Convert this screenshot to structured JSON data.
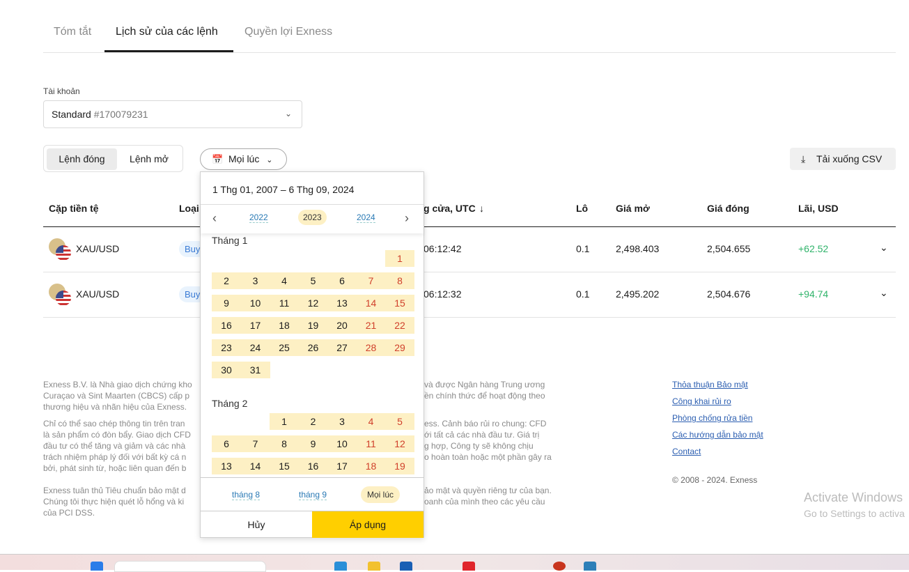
{
  "tabs": [
    {
      "label": "Tóm tắt"
    },
    {
      "label": "Lịch sử của các lệnh"
    },
    {
      "label": "Quyền lợi Exness"
    }
  ],
  "account": {
    "label": "Tài khoản",
    "type": "Standard",
    "number": "#170079231"
  },
  "order_toggle": {
    "closed": "Lệnh đóng",
    "open": "Lệnh mở"
  },
  "period_button": "Mọi lúc",
  "download_csv": "Tải xuống CSV",
  "table": {
    "headers": [
      "Cặp tiền tệ",
      "Loại",
      "g cửa, UTC",
      "Lô",
      "Giá mở",
      "Giá đóng",
      "Lãi, USD"
    ],
    "rows": [
      {
        "pair": "XAU/USD",
        "type": "Buy",
        "time": "06:12:42",
        "lot": "0.1",
        "open": "2,498.403",
        "close": "2,504.655",
        "profit": "+62.52"
      },
      {
        "pair": "XAU/USD",
        "type": "Buy",
        "time": "06:12:32",
        "lot": "0.1",
        "open": "2,495.202",
        "close": "2,504.676",
        "profit": "+94.74"
      }
    ]
  },
  "datepicker": {
    "range": "1 Thg 01, 2007 – 6 Thg 09, 2024",
    "years": [
      "2022",
      "2023",
      "2024"
    ],
    "selected_year": "2023",
    "months": [
      {
        "label": "Tháng 1",
        "offset": 6,
        "days": 31
      },
      {
        "label": "Tháng 2",
        "offset": 2,
        "days": 19
      }
    ],
    "quick": [
      "tháng 8",
      "tháng 9",
      "Mọi lúc"
    ],
    "cancel": "Hủy",
    "apply": "Áp dụng"
  },
  "footer": {
    "p1a": "Exness B.V. là Nhà giao dịch chứng kho",
    "p1b": "và được Ngân hàng Trung ương",
    "p1c": "Curaçao và Sint Maarten (CBCS) cấp p",
    "p1d": "ền chính thức để hoạt động theo",
    "p1e": "thương hiệu và nhãn hiệu của Exness.",
    "p2a": "Chỉ có thể sao chép thông tin trên tran",
    "p2b": "ess. Cảnh báo rủi ro chung: CFD",
    "p2c": "là sản phẩm có đòn bẩy. Giao dịch CFD",
    "p2d": "ới tất cả các nhà đầu tư. Giá trị",
    "p2e": "đầu tư có thể tăng và giảm và các nhà",
    "p2f": "g hợp, Công ty sẽ không chịu",
    "p2g": "trách nhiệm pháp lý đối với bất kỳ cá n",
    "p2h": "o hoàn toàn hoặc một phần gây ra",
    "p2i": "bởi, phát sinh từ, hoặc liên quan đến b",
    "p3a": "Exness tuân thủ Tiêu chuẩn bảo mật d",
    "p3b": "ảo mật và quyền riêng tư của bạn.",
    "p3c": "Chúng tôi thực hiện quét lỗ hổng và ki",
    "p3d": "oanh của mình theo các yêu cầu",
    "p3e": "của PCI DSS.",
    "links": [
      "Thỏa thuận Bảo mật",
      "Công khai rủi ro",
      "Phòng chống rửa tiền",
      "Các hướng dẫn bảo mật",
      "Contact"
    ],
    "copyright": "© 2008 - 2024. Exness"
  },
  "watermark": {
    "title": "Activate Windows",
    "sub": "Go to Settings to activa"
  },
  "colors": {
    "accent": "#ffcf00",
    "profit": "#2fb36a",
    "weekend": "#d0402b",
    "day_bg": "#fdf0c4"
  }
}
